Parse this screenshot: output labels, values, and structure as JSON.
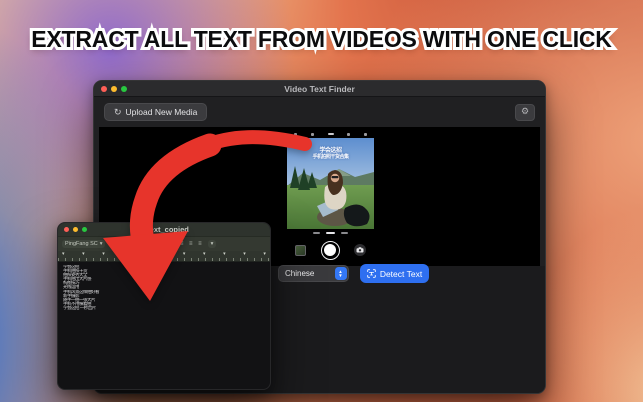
{
  "hero": {
    "title": "EXTRACT ALL TEXT FROM VIDEOS WITH ONE CLICK"
  },
  "colors": {
    "accent_blue": "#2E6FF0",
    "popup_chev_blue": "#3478F6",
    "arrow_red": "#E7342B",
    "traffic_red": "#FF5F57",
    "traffic_yellow": "#FEBC2E",
    "traffic_green": "#28C840"
  },
  "main_window": {
    "title": "Video Text Finder",
    "toolbar": {
      "upload_label": "Upload New Media",
      "upload_icon": "circular-arrow",
      "settings_icon": "gear",
      "gear_glyph": "⚙",
      "upload_glyph": "↻"
    },
    "video": {
      "overlay_line1": "学会这招",
      "overlay_line2": "手机拍照干货合集",
      "camera_ui": {
        "shutter_icon": "white-circle",
        "flip_camera_icon": "camera",
        "last_photo_thumbnail": "green-landscape"
      }
    },
    "controls": {
      "language_value": "Chinese",
      "detect_label": "Detect Text",
      "detect_icon": "text-viewfinder",
      "popup_chevrons_up": "▲",
      "popup_chevrons_down": "▼"
    }
  },
  "editor_window": {
    "title": "text_copied",
    "doc_icon": "document",
    "format_bar": {
      "font_name": "PingFang SC",
      "font_chevron": "▾",
      "style_glyphs": "B I U",
      "align_glyphs": "≡ ≡ ≡",
      "list_chevron": "▾"
    },
    "ruler_marker": "▾",
    "lines": [
      "学会这招",
      "手机拍照干货",
      "拍照姿势大全",
      "手机拍出大片感",
      "构图技巧",
      "光线运用",
      "手机风景这样拍好看",
      "新手摄影",
      "随手一拍一张大片",
      "手机不用横着拍",
      "学会这招 一秒出片"
    ]
  }
}
